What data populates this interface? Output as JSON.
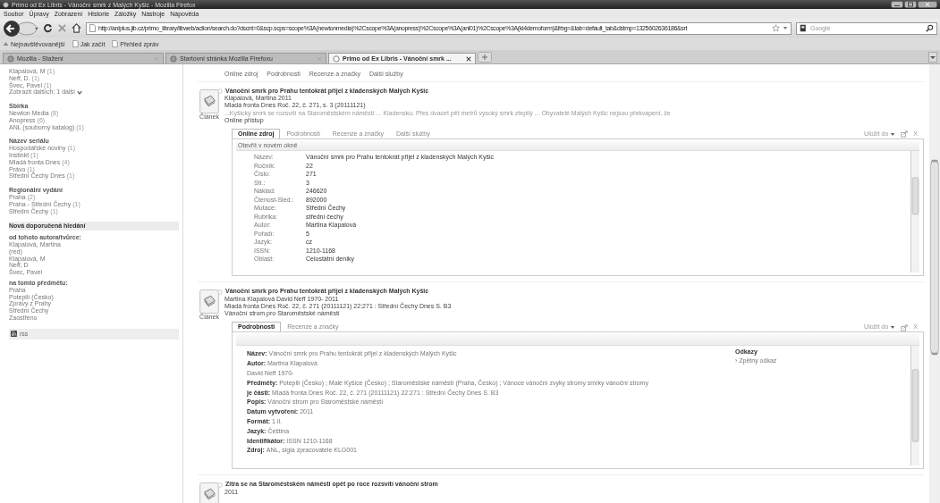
{
  "window": {
    "title": "Primo od Ex Libris - Vánoční smrk z Malých Kyšic - Mozilla Firefox"
  },
  "menu": [
    "Soubor",
    "Úpravy",
    "Zobrazení",
    "Historie",
    "Záložky",
    "Nástroje",
    "Nápověda"
  ],
  "address": {
    "value": "http://anlplus.jib.cz/primo_library/libweb/action/search.do?dscnt=0&scp.scps=scope%3A(newtonmedia)%2Cscope%3A(anopress)%2Cscope%3A(anl01)%2Cscope%3A(kl4demoform)&frbg=&tab=default_tab&dstmp=1325602636186&srt"
  },
  "search": {
    "placeholder": "Google"
  },
  "bookmarks": [
    "Nejnavštěvovanější",
    "Jak začít",
    "Přehled zpráv"
  ],
  "tabs": [
    {
      "label": "Mozilla - Stažení",
      "selected": false
    },
    {
      "label": "Startovní stránka Mozilla Firefoxu",
      "selected": false
    },
    {
      "label": "Primo od Ex Libris - Vánoční smrk ...",
      "selected": true
    }
  ],
  "sidebar": {
    "top_items": [
      {
        "label": "Klapalová, M",
        "count": "(1)"
      },
      {
        "label": "Neff, D.",
        "count": "(1)"
      },
      {
        "label": "Švec, Pavel",
        "count": "(1)"
      }
    ],
    "show_more": "Zobrazit dalších: 1 další",
    "facets": [
      {
        "title": "Sbírka",
        "items": [
          {
            "label": "Newton Media",
            "count": "(8)"
          },
          {
            "label": "Anopress",
            "count": "(6)"
          },
          {
            "label": "ANL (souborný katalog)",
            "count": "(1)"
          }
        ]
      },
      {
        "title": "Název seriálu",
        "items": [
          {
            "label": "Hospodářské noviny",
            "count": "(1)"
          },
          {
            "label": "Instinkt",
            "count": "(1)"
          },
          {
            "label": "Mladá fronta Dnes",
            "count": "(4)"
          },
          {
            "label": "Právo",
            "count": "(1)"
          },
          {
            "label": "Střední Čechy Dnes",
            "count": "(1)"
          }
        ]
      },
      {
        "title": "Regionální vydání",
        "items": [
          {
            "label": "Praha",
            "count": "(2)"
          },
          {
            "label": "Praha - Střední Čechy",
            "count": "(1)"
          },
          {
            "label": "Střední Čechy",
            "count": "(1)"
          }
        ]
      }
    ],
    "suggestions": {
      "title": "Nová doporučená hledání",
      "groups": [
        {
          "title": "od tohoto autora/tvůrce:",
          "items": [
            "Klapalová, Martina",
            "(red)",
            "Klapalová, M",
            "Neff, D",
            "Švec, Pavel"
          ]
        },
        {
          "title": "na tomto předmětu:",
          "items": [
            "Praha",
            "Potepilí (Česko)",
            "Zprávy z Prahy",
            "Střední Čechy",
            "Zaostřeno"
          ]
        }
      ]
    },
    "rss": "rss"
  },
  "top_links": [
    "Online zdroj",
    "Podrobnosti",
    "Recenze a značky",
    "Další služby"
  ],
  "results": [
    {
      "selected": false,
      "type_label": "Článek",
      "title": "Vánoční smrk pro Prahu tentokrát přijel z kladenských Malých Kyšic",
      "lines": [
        "Klapalová, Martina 2011",
        "Mladá fronta Dnes Roč. 22, č. 271, s. 3 (20111121)"
      ],
      "snippet": "...Kyšický smrk se rozsvítí na Staroměstském náměstí ... Kladensku. Přes dvacet pět metrů vysoký smrk ztepilý ... Obyvatelé Malých Kyšic nejsou překvapeni, že",
      "access": "Online přístup",
      "tabs": [
        {
          "label": "Online zdroj",
          "selected": true
        },
        {
          "label": "Podrobnosti",
          "selected": false
        },
        {
          "label": "Recenze a značky",
          "selected": false
        },
        {
          "label": "Další služby",
          "selected": false
        }
      ],
      "save": "Uložit do",
      "close": "X",
      "panel": {
        "kind": "online",
        "open_link": "Otevřít v novém okně",
        "fields": [
          {
            "label": "Název:",
            "value": "Vánoční smrk pro Prahu tentokrát přijel z kladenských Malých Kyšic"
          },
          {
            "label": "Ročník:",
            "value": "22"
          },
          {
            "label": "Číslo:",
            "value": "271"
          },
          {
            "label": "Str.:",
            "value": "3"
          },
          {
            "label": "Náklad:",
            "value": "246620"
          },
          {
            "label": "Čtenost-Sled.:",
            "value": "892000"
          },
          {
            "label": "Mutace:",
            "value": "Střední Čechy"
          },
          {
            "label": "Rubrika:",
            "value": "střední čechy"
          },
          {
            "label": "Autor:",
            "value": "Martina Klapalová"
          },
          {
            "label": "Pořadí:",
            "value": "5"
          },
          {
            "label": "Jazyk:",
            "value": "cz"
          },
          {
            "label": "ISSN:",
            "value": "1210-1168"
          },
          {
            "label": "Oblast:",
            "value": "Celostátní deníky"
          }
        ]
      }
    },
    {
      "selected": false,
      "type_label": "Článek",
      "title": "Vánoční smrk pro Prahu tentokrát přijel z kladenských Malých Kyšic",
      "lines": [
        "Martina Klapalová David Neff 1970- 2011",
        "Mladá fronta Dnes Roč. 22, č. 271 (20111121) 22:271 : Střední Čechy Dnes S. B3",
        "Vánoční strom pro Staroměstské náměstí"
      ],
      "tabs": [
        {
          "label": "Podrobnosti",
          "selected": true
        },
        {
          "label": "Recenze a značky",
          "selected": false
        }
      ],
      "save": "Uložit do",
      "close": "X",
      "panel": {
        "kind": "details",
        "rows": [
          {
            "label": "Název:",
            "value": "Vánoční smrk pro Prahu tentokrát přijel z kladenských Malých Kyšic"
          },
          {
            "label": "Autor:",
            "value": "Martina Klapalová"
          },
          {
            "value": "David Neff 1970-"
          },
          {
            "label": "Předměty:",
            "value": "Potepilí (Česko) ; Malé Kyšice (Česko) ; Staroměstské náměstí (Praha, Česko) ; Vánoce vánoční zvyky stromy smrky vánoční stromy"
          },
          {
            "label": "je části:",
            "value": "Mladá fronta Dnes Roč. 22, č. 271 (20111121) 22:271 : Střední Čechy Dnes S. B3"
          },
          {
            "label": "Popis:",
            "value": "Vánoční strom pro Staroměstské náměstí"
          },
          {
            "label": "Datum vytvoření:",
            "value": "2011"
          },
          {
            "label": "Formát:",
            "value": "1 il."
          },
          {
            "label": "Jazyk:",
            "value": "Čeština"
          },
          {
            "label": "Identifikátor:",
            "value": "ISSN 1210-1168"
          },
          {
            "label": "Zdroj:",
            "value": "ANL, sigla zpracovatele KLG001"
          }
        ],
        "links_title": "Odkazy",
        "links": [
          "› Zpětný odkaz"
        ]
      }
    },
    {
      "selected": false,
      "title": "Zítra se na Staroměstském náměstí opět po roce rozsvítí vánoční strom",
      "lines": [
        "2011"
      ]
    }
  ]
}
